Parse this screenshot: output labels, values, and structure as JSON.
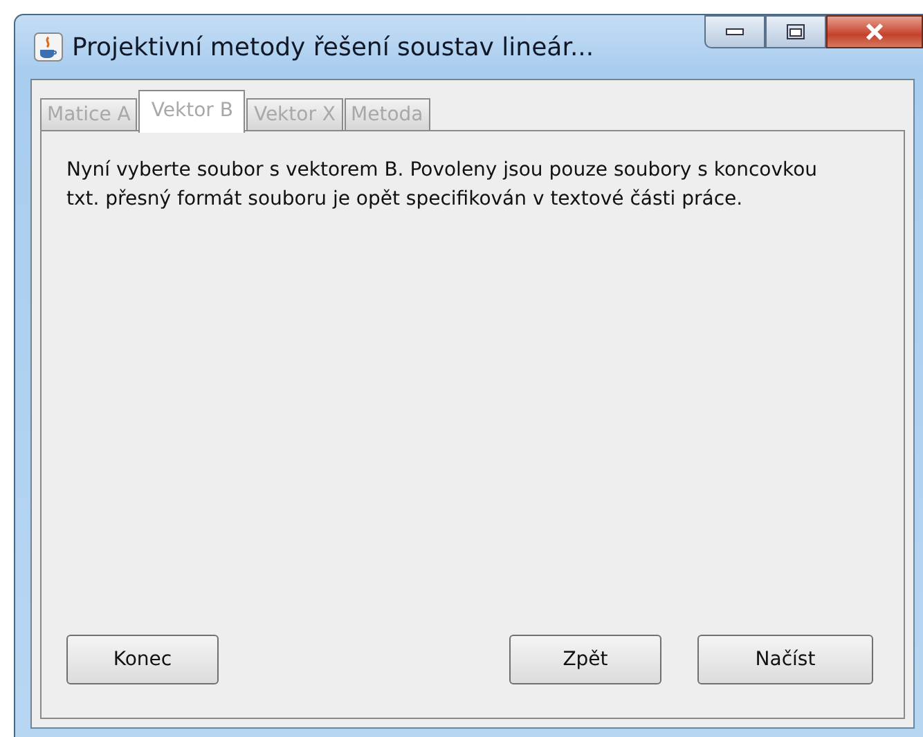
{
  "window": {
    "title": "Projektivní metody řešení soustav lineár..."
  },
  "tabs": [
    {
      "label": "Matice A",
      "selected": false,
      "disabled": true
    },
    {
      "label": "Vektor B",
      "selected": true,
      "disabled": true
    },
    {
      "label": "Vektor X",
      "selected": false,
      "disabled": true
    },
    {
      "label": "Metoda",
      "selected": false,
      "disabled": true
    }
  ],
  "message": "Nyní vyberte soubor s vektorem B. Povoleny jsou pouze soubory s koncovkou txt. přesný formát souboru je opět specifikován v textové části práce.",
  "buttons_left": [
    "Konec"
  ],
  "buttons_right": [
    "Zpět",
    "Načíst"
  ]
}
